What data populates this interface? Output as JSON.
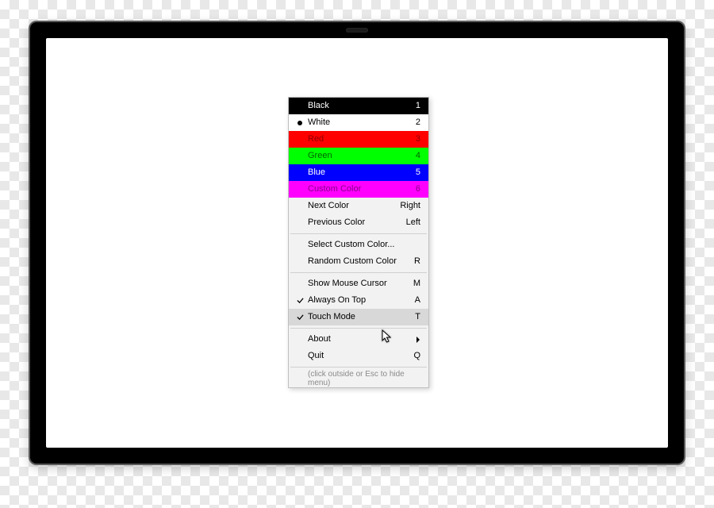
{
  "colors": [
    {
      "label": "Black",
      "shortcut": "1",
      "bg": "#000000",
      "fg": "#ffffff",
      "selected": false
    },
    {
      "label": "White",
      "shortcut": "2",
      "bg": "#ffffff",
      "fg": "#000000",
      "selected": true
    },
    {
      "label": "Red",
      "shortcut": "3",
      "bg": "#ff0000",
      "fg": "#8a0000",
      "selected": false
    },
    {
      "label": "Green",
      "shortcut": "4",
      "bg": "#00ff00",
      "fg": "#006400",
      "selected": false
    },
    {
      "label": "Blue",
      "shortcut": "5",
      "bg": "#0000ff",
      "fg": "#ffffff",
      "selected": false
    },
    {
      "label": "Custom Color",
      "shortcut": "6",
      "bg": "#ff00ff",
      "fg": "#8a008a",
      "selected": false
    }
  ],
  "nav": {
    "next": {
      "label": "Next Color",
      "shortcut": "Right"
    },
    "prev": {
      "label": "Previous Color",
      "shortcut": "Left"
    }
  },
  "custom": {
    "select": {
      "label": "Select Custom Color..."
    },
    "random": {
      "label": "Random Custom Color",
      "shortcut": "R"
    }
  },
  "options": {
    "cursor": {
      "label": "Show Mouse Cursor",
      "shortcut": "M",
      "checked": false
    },
    "ontop": {
      "label": "Always On Top",
      "shortcut": "A",
      "checked": true
    },
    "touch": {
      "label": "Touch Mode",
      "shortcut": "T",
      "checked": true,
      "hovered": true
    }
  },
  "footer": {
    "about": {
      "label": "About"
    },
    "quit": {
      "label": "Quit",
      "shortcut": "Q"
    }
  },
  "hint": "(click outside or Esc to hide menu)"
}
